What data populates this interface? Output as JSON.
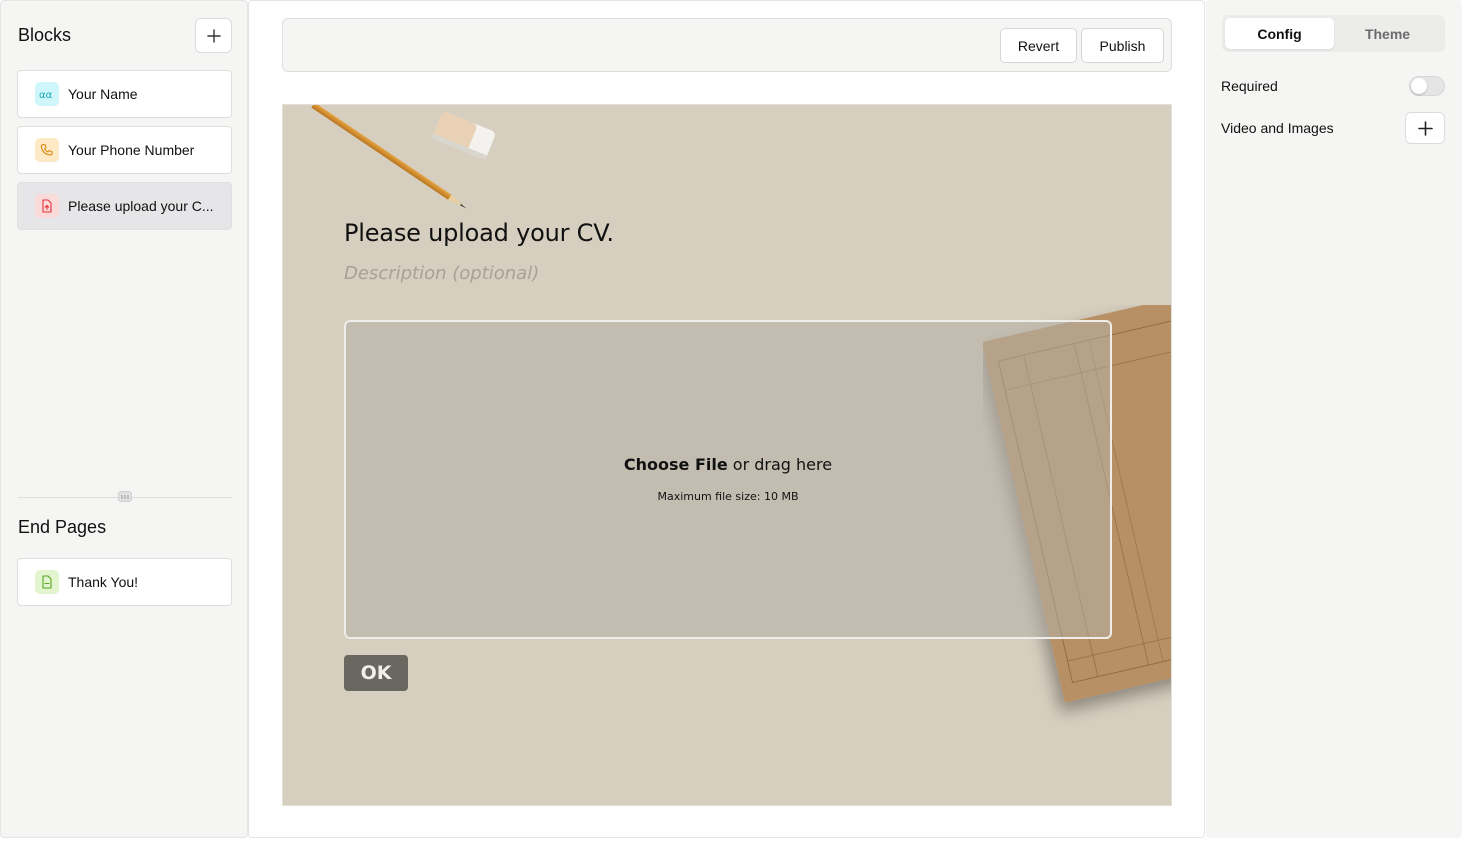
{
  "sidebar": {
    "blocks_title": "Blocks",
    "blocks": [
      {
        "label": "Your Name",
        "icon": "text-input-icon",
        "color": "#cff6fb"
      },
      {
        "label": "Your Phone Number",
        "icon": "phone-icon",
        "color": "#fde9c5"
      },
      {
        "label": "Please upload your C...",
        "icon": "file-upload-icon",
        "color": "#fbdada",
        "active": true
      }
    ],
    "end_pages_title": "End Pages",
    "end_pages": [
      {
        "label": "Thank You!",
        "icon": "document-icon",
        "color": "#e2f5cf"
      }
    ]
  },
  "toolbar": {
    "revert_label": "Revert",
    "publish_label": "Publish"
  },
  "form": {
    "title": "Please upload your CV.",
    "description_placeholder": "Description (optional)",
    "upload_choose": "Choose File",
    "upload_rest": " or drag here",
    "upload_limit": "Maximum file size: 10 MB",
    "ok_label": "OK",
    "background_color": "#d6cebe",
    "button_color": "#6a6760"
  },
  "settings": {
    "tabs": [
      "Config",
      "Theme"
    ],
    "active_tab": "Config",
    "required_label": "Required",
    "required_on": false,
    "media_label": "Video and Images"
  }
}
